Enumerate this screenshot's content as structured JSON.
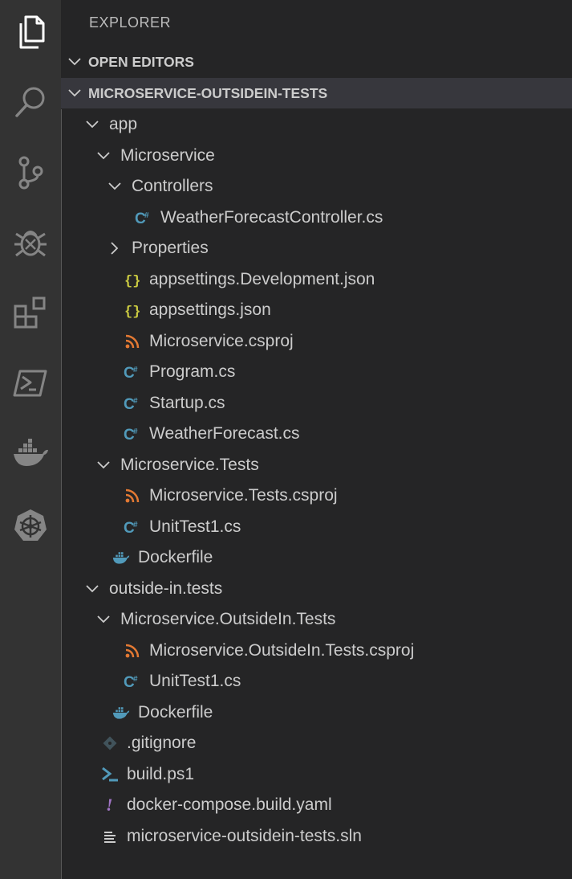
{
  "activity_bar": {
    "items": [
      "explorer-icon",
      "search-icon",
      "source-control-icon",
      "debug-icon",
      "extensions-icon",
      "powershell-icon",
      "docker-icon",
      "kubernetes-icon"
    ]
  },
  "sidebar": {
    "title": "EXPLORER",
    "open_editors": "OPEN EDITORS",
    "project": "MICROSERVICE-OUTSIDEIN-TESTS"
  },
  "tree": [
    {
      "label": "app",
      "depth": 0,
      "type": "folder",
      "open": true
    },
    {
      "label": "Microservice",
      "depth": 1,
      "type": "folder",
      "open": true
    },
    {
      "label": "Controllers",
      "depth": 2,
      "type": "folder",
      "open": true
    },
    {
      "label": "WeatherForecastController.cs",
      "depth": 3,
      "type": "cs"
    },
    {
      "label": "Properties",
      "depth": 2,
      "type": "folder",
      "open": false
    },
    {
      "label": "appsettings.Development.json",
      "depth": 2,
      "type": "json"
    },
    {
      "label": "appsettings.json",
      "depth": 2,
      "type": "json"
    },
    {
      "label": "Microservice.csproj",
      "depth": 2,
      "type": "csproj"
    },
    {
      "label": "Program.cs",
      "depth": 2,
      "type": "cs"
    },
    {
      "label": "Startup.cs",
      "depth": 2,
      "type": "cs"
    },
    {
      "label": "WeatherForecast.cs",
      "depth": 2,
      "type": "cs"
    },
    {
      "label": "Microservice.Tests",
      "depth": 1,
      "type": "folder",
      "open": true
    },
    {
      "label": "Microservice.Tests.csproj",
      "depth": 2,
      "type": "csproj"
    },
    {
      "label": "UnitTest1.cs",
      "depth": 2,
      "type": "cs"
    },
    {
      "label": "Dockerfile",
      "depth": 1,
      "type": "docker"
    },
    {
      "label": "outside-in.tests",
      "depth": 0,
      "type": "folder",
      "open": true
    },
    {
      "label": "Microservice.OutsideIn.Tests",
      "depth": 1,
      "type": "folder",
      "open": true
    },
    {
      "label": "Microservice.OutsideIn.Tests.csproj",
      "depth": 2,
      "type": "csproj"
    },
    {
      "label": "UnitTest1.cs",
      "depth": 2,
      "type": "cs"
    },
    {
      "label": "Dockerfile",
      "depth": 1,
      "type": "docker"
    },
    {
      "label": ".gitignore",
      "depth": 0,
      "type": "git"
    },
    {
      "label": "build.ps1",
      "depth": 0,
      "type": "ps1"
    },
    {
      "label": "docker-compose.build.yaml",
      "depth": 0,
      "type": "yaml"
    },
    {
      "label": "microservice-outsidein-tests.sln",
      "depth": 0,
      "type": "sln"
    }
  ],
  "colors": {
    "cs": "#519aba",
    "json": "#cbcb41",
    "csproj": "#e37933",
    "docker": "#519aba",
    "git": "#41535b",
    "ps1": "#519aba",
    "yaml": "#a074c4",
    "sln": "#cccccc"
  }
}
